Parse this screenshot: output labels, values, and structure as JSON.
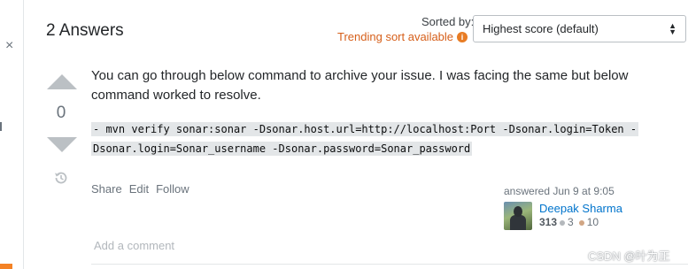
{
  "answers_header": {
    "title": "2 Answers"
  },
  "sort": {
    "label": "Sorted by:",
    "trending_text": "Trending sort available",
    "info_glyph": "i",
    "selected": "Highest score (default)"
  },
  "sidebar": {
    "close_glyph": "×"
  },
  "answer": {
    "vote_count": "0",
    "body": "You can go through below command to archive your issue. I was facing the same but below command worked to resolve.",
    "code": "- mvn verify sonar:sonar -Dsonar.host.url=http://localhost:Port -Dsonar.login=Token -Dsonar.login=Sonar_username -Dsonar.password=Sonar_password",
    "menu": {
      "share": "Share",
      "edit": "Edit",
      "follow": "Follow"
    },
    "answered": "answered Jun 9 at 9:05",
    "user": {
      "name": "Deepak Sharma",
      "reputation": "313",
      "silver_badges": "3",
      "bronze_badges": "10"
    },
    "add_comment": "Add a comment"
  },
  "watermark": "CSDN @叶为正",
  "colors": {
    "accent_orange": "#d65f1a",
    "link_blue": "#0074cc",
    "vote_arrow": "#bbc0c4"
  },
  "icons": {
    "close": "close-icon",
    "info": "info-icon",
    "select_arrows": "chevron-updown-icon",
    "upvote": "upvote-arrow-icon",
    "downvote": "downvote-arrow-icon",
    "history": "history-icon"
  }
}
